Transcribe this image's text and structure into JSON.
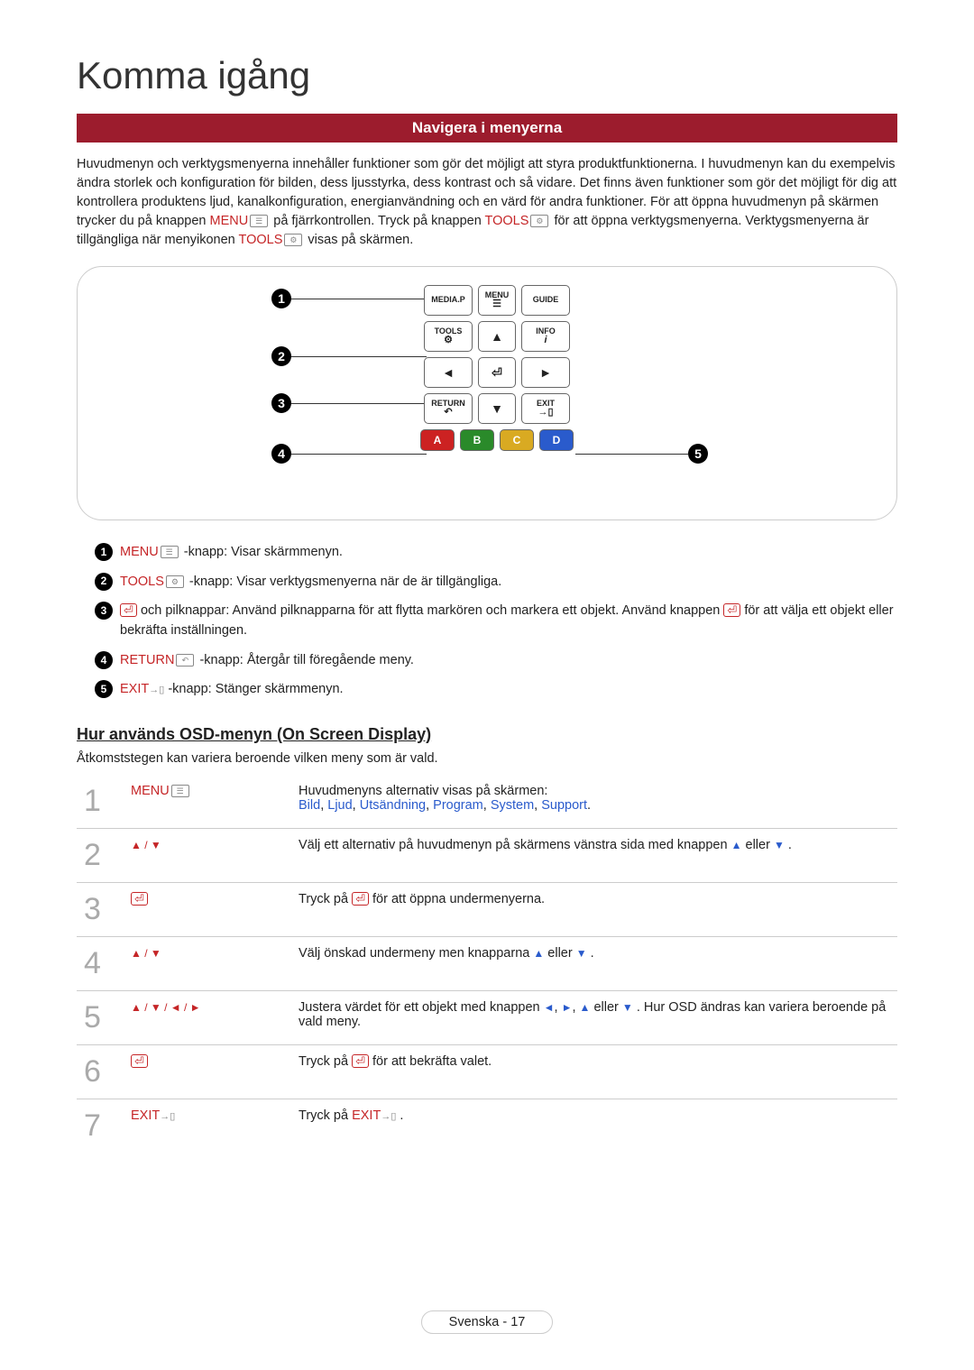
{
  "page_title": "Komma igång",
  "section_bar": "Navigera i menyerna",
  "intro": {
    "line1": "Huvudmenyn och verktygsmenyerna innehåller funktioner som gör det möjligt att styra produktfunktionerna. I huvudmenyn kan du exempelvis ändra storlek och konfiguration för bilden, dess ljusstyrka, dess kontrast och så vidare. Det finns även funktioner som gör det möjligt för dig att kontrollera produktens ljud, kanalkonfiguration, energianvändning och en värd för andra funktioner. För att öppna huvudmenyn på skärmen trycker du på knappen ",
    "menu_word": "MENU",
    "line2": " på fjärrkontrollen. Tryck på knappen ",
    "tools_word": "TOOLS",
    "line3": " för att öppna verktygsmenyerna. Verktygsmenyerna är tillgängliga när menyikonen ",
    "line4": " visas på skärmen."
  },
  "remote": {
    "MEDIA_P": "MEDIA.P",
    "MENU": "MENU",
    "GUIDE": "GUIDE",
    "TOOLS": "TOOLS",
    "INFO": "INFO",
    "RETURN": "RETURN",
    "EXIT": "EXIT",
    "A": "A",
    "B": "B",
    "C": "C",
    "D": "D"
  },
  "callouts": [
    {
      "n": "1",
      "label": "MENU",
      "text": "-knapp: Visar skärmmenyn."
    },
    {
      "n": "2",
      "label": "TOOLS",
      "text": "-knapp: Visar verktygsmenyerna när de är tillgängliga."
    },
    {
      "n": "3",
      "label": "",
      "text_a": " och pilknappar: Använd pilknapparna för att flytta markören och markera ett objekt. Använd knappen ",
      "text_b": " för att välja ett objekt eller bekräfta inställningen."
    },
    {
      "n": "4",
      "label": "RETURN",
      "text": "-knapp: Återgår till föregående meny."
    },
    {
      "n": "5",
      "label": "EXIT",
      "text": "-knapp: Stänger skärmmenyn."
    }
  ],
  "osd_heading": "Hur används OSD-menyn (On Screen Display)",
  "osd_sub": "Åtkomststegen kan variera beroende vilken meny som är vald.",
  "steps": [
    {
      "n": "1",
      "key": "MENU",
      "desc_a": "Huvudmenyns alternativ visas på skärmen:",
      "cats": [
        "Bild",
        "Ljud",
        "Utsändning",
        "Program",
        "System",
        "Support"
      ]
    },
    {
      "n": "2",
      "key": "▲ / ▼",
      "desc_a": "Välj ett alternativ på huvudmenyn på skärmens vänstra sida med knappen ",
      "desc_b": " eller ",
      "desc_c": "."
    },
    {
      "n": "3",
      "key": "enter",
      "desc_a": "Tryck på ",
      "desc_b": " för att öppna undermenyerna."
    },
    {
      "n": "4",
      "key": "▲ / ▼",
      "desc_a": "Välj önskad undermeny men knapparna ",
      "desc_b": " eller ",
      "desc_c": "."
    },
    {
      "n": "5",
      "key": "▲ / ▼ / ◄ / ►",
      "desc_a": "Justera värdet för ett objekt med knappen ",
      "desc_b": " . Hur OSD ändras kan variera beroende på vald meny."
    },
    {
      "n": "6",
      "key": "enter",
      "desc_a": "Tryck på ",
      "desc_b": " för att bekräfta valet."
    },
    {
      "n": "7",
      "key": "EXIT",
      "desc_a": "Tryck på ",
      "desc_b": "."
    }
  ],
  "footer": {
    "lang": "Svenska",
    "sep": " - ",
    "page": "17"
  }
}
